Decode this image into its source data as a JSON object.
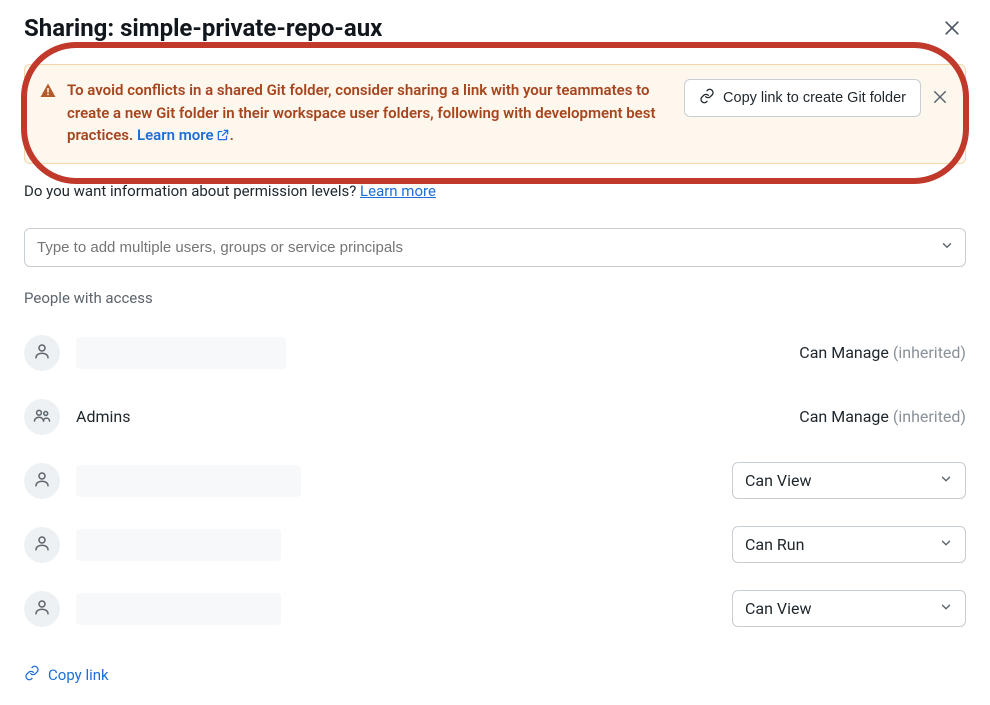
{
  "header": {
    "title": "Sharing: simple-private-repo-aux"
  },
  "alert": {
    "text_pre": "To avoid conflicts in a shared Git folder, consider sharing a link with your teammates to create a new Git folder in their workspace user folders, following with development best practices. ",
    "learn_more": "Learn more",
    "period": ".",
    "button": "Copy link to create Git folder"
  },
  "perm_info": {
    "question": "Do you want information about permission levels? ",
    "learn_more": "Learn more"
  },
  "add_input": {
    "placeholder": "Type to add multiple users, groups or service principals"
  },
  "section_label": "People with access",
  "rows": {
    "r0": {
      "name": "",
      "perm": "Can Manage",
      "inherited": " (inherited)"
    },
    "r1": {
      "name": "Admins",
      "perm": "Can Manage",
      "inherited": " (inherited)"
    },
    "r2": {
      "name": "",
      "perm": "Can View"
    },
    "r3": {
      "name": "",
      "perm": "Can Run"
    },
    "r4": {
      "name": "",
      "perm": "Can View"
    }
  },
  "footer": {
    "copy_link": "Copy link"
  }
}
